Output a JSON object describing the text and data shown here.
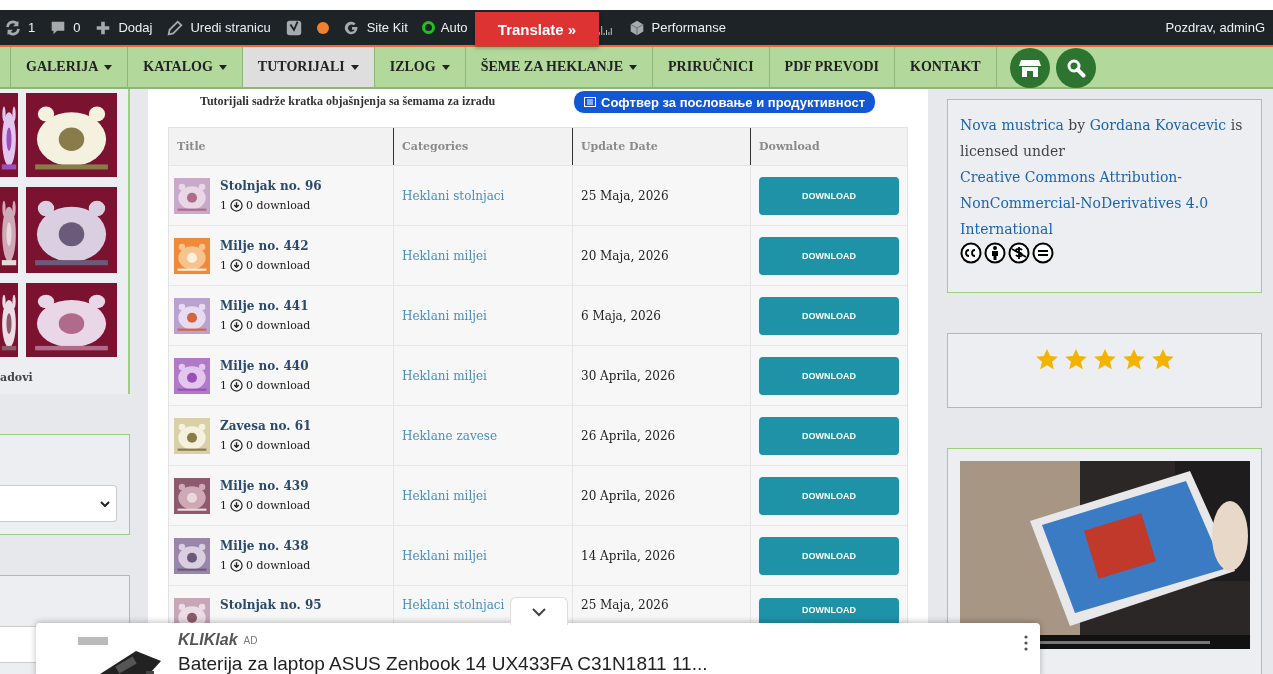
{
  "admin_bar": {
    "items": [
      {
        "kind": "refresh",
        "label": "1"
      },
      {
        "kind": "comments",
        "label": "0"
      },
      {
        "kind": "add",
        "label": "Dodaj"
      },
      {
        "kind": "edit",
        "label": "Uredi stranicu"
      },
      {
        "kind": "yoast"
      },
      {
        "kind": "dot",
        "color": "#f0812d"
      },
      {
        "kind": "google",
        "label": "Site Kit"
      },
      {
        "kind": "ring",
        "label": "Auto",
        "color": "#1ec31e"
      },
      {
        "kind": "graph"
      },
      {
        "kind": "cube",
        "label": "Performanse"
      }
    ],
    "greeting": "Pozdrav, adminG"
  },
  "translate_button": "Translate »",
  "nav": {
    "items": [
      {
        "label": "GALERIJA",
        "dropdown": true,
        "selected": false
      },
      {
        "label": "KATALOG",
        "dropdown": true,
        "selected": false
      },
      {
        "label": "TUTORIJALI",
        "dropdown": true,
        "selected": true
      },
      {
        "label": "IZLOG",
        "dropdown": true,
        "selected": false
      },
      {
        "label": "ŠEME ZA HEKLANJE",
        "dropdown": true,
        "selected": false
      },
      {
        "label": "PRIRUČNICI",
        "dropdown": false,
        "selected": false
      },
      {
        "label": "PDF PREVODI",
        "dropdown": false,
        "selected": false
      },
      {
        "label": "KONTAKT",
        "dropdown": false,
        "selected": false
      }
    ]
  },
  "left_sidebar": {
    "gallery_caption": "adovi"
  },
  "intro": "Tutorijali sadrže kratka objašnjenja sa šemama za izradu",
  "promo_pill": "Софтвер за пословање и продуктивност",
  "table": {
    "columns": [
      "Title",
      "Categories",
      "Update Date",
      "Download"
    ],
    "rows": [
      {
        "title": "Stolnjak no. 96",
        "views": "1",
        "downloads": "0 download",
        "category": "Heklani stolnjaci",
        "date": "25 Maja, 2026",
        "button": "DOWNLOAD"
      },
      {
        "title": "Milje no. 442",
        "views": "1",
        "downloads": "0 download",
        "category": "Heklani miljei",
        "date": "20 Maja, 2026",
        "button": "DOWNLOAD"
      },
      {
        "title": "Milje no. 441",
        "views": "1",
        "downloads": "0 download",
        "category": "Heklani miljei",
        "date": "6 Maja, 2026",
        "button": "DOWNLOAD"
      },
      {
        "title": "Milje no. 440",
        "views": "1",
        "downloads": "0 download",
        "category": "Heklani miljei",
        "date": "30 Aprila, 2026",
        "button": "DOWNLOAD"
      },
      {
        "title": "Zavesa no. 61",
        "views": "1",
        "downloads": "0 download",
        "category": "Heklane zavese",
        "date": "26 Aprila, 2026",
        "button": "DOWNLOAD"
      },
      {
        "title": "Milje no. 439",
        "views": "1",
        "downloads": "0 download",
        "category": "Heklani miljei",
        "date": "20 Aprila, 2026",
        "button": "DOWNLOAD"
      },
      {
        "title": "Milje no. 438",
        "views": "1",
        "downloads": "0 download",
        "category": "Heklani miljei",
        "date": "14 Aprila, 2026",
        "button": "DOWNLOAD"
      },
      {
        "title": "Stolnjak no. 95",
        "category": "Heklani stolnjaci",
        "date": "25 Maja, 2026",
        "button": "DOWNLOAD"
      }
    ]
  },
  "license": {
    "work": "Nova mustrica",
    "by": "by",
    "author": "Gordana Kovacevic",
    "text": "is licensed under",
    "license": "Creative Commons Attribution-NonCommercial-NoDerivatives 4.0 International"
  },
  "rating": {
    "stars": 5
  },
  "ad": {
    "brand": "KLIKlak",
    "badge": "AD",
    "title": "Baterija za laptop ASUS Zenbook 14 UX433FA C31N1811 11..."
  }
}
